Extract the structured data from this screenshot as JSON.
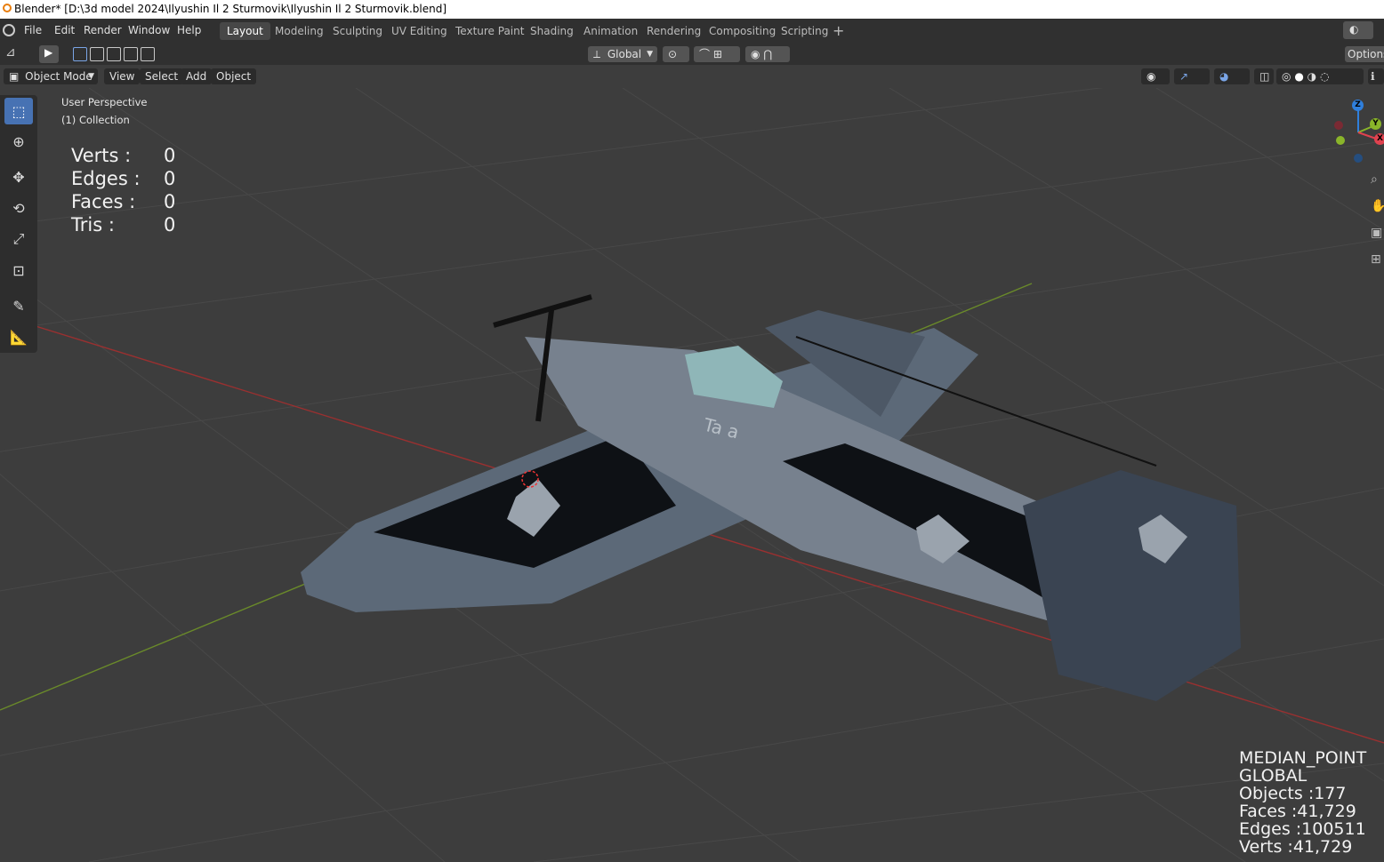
{
  "window": {
    "title": "Blender* [D:\\3d model 2024\\Ilyushin Il 2 Sturmovik\\Ilyushin Il 2 Sturmovik.blend]"
  },
  "menu": {
    "file": "File",
    "edit": "Edit",
    "render": "Render",
    "window": "Window",
    "help": "Help"
  },
  "workspaces": [
    "Layout",
    "Modeling",
    "Sculpting",
    "UV Editing",
    "Texture Paint",
    "Shading",
    "Animation",
    "Rendering",
    "Compositing",
    "Scripting"
  ],
  "active_workspace": "Layout",
  "tool_header": {
    "orientation": "Global",
    "options": "Options"
  },
  "view_header": {
    "mode": "Object Mode",
    "view": "View",
    "select": "Select",
    "add": "Add",
    "object": "Object"
  },
  "overlay": {
    "perspective": "User Perspective",
    "collection": "(1) Collection",
    "stats": [
      {
        "label": "Verts :",
        "value": "0"
      },
      {
        "label": "Edges :",
        "value": "0"
      },
      {
        "label": "Faces :",
        "value": "0"
      },
      {
        "label": "Tris :",
        "value": "0"
      }
    ],
    "bottom_stats": {
      "pivot": "MEDIAN_POINT",
      "orientation": "GLOBAL",
      "objects": "Objects :177",
      "faces": "Faces :41,729",
      "edges": "Edges :100511",
      "verts": "Verts :41,729"
    },
    "fuselage_text": "Ta   a"
  },
  "gizmo": {
    "x": "X",
    "y": "Y",
    "z": "Z"
  },
  "colors": {
    "accent": "#4772b3",
    "x_axis": "#e0424f",
    "y_axis": "#8ab52a",
    "z_axis": "#2f7fdc",
    "viewport_bg": "#3d3d3d"
  }
}
